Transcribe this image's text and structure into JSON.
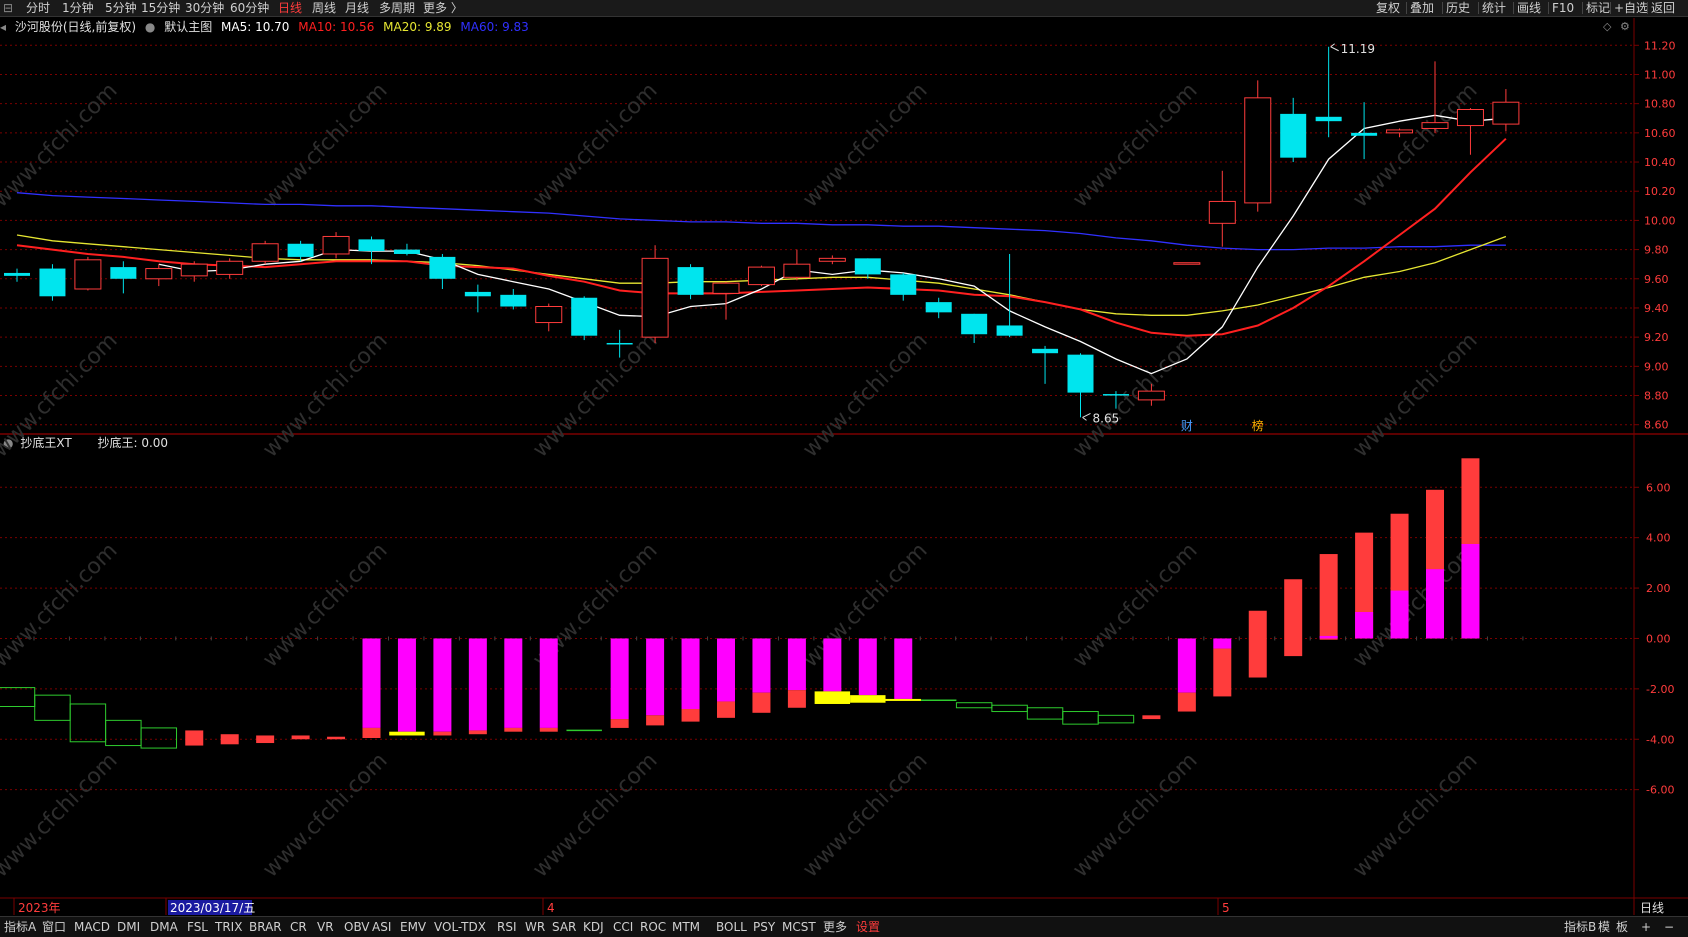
{
  "top_menu": {
    "left_items": [
      "分时",
      "1分钟",
      "5分钟",
      "15分钟",
      "30分钟",
      "60分钟",
      "日线",
      "周线",
      "月线",
      "多周期",
      "更多 〉"
    ],
    "active_index": 6,
    "right_items": [
      "复权",
      "叠加",
      "历史",
      "统计",
      "画线",
      "F10",
      "标记",
      "+自选",
      "返回"
    ]
  },
  "main_chart_info": {
    "stock": "沙河股份(日线,前复权)",
    "template": "默认主图",
    "ma5": "MA5: 10.70",
    "ma10": "MA10: 10.56",
    "ma20": "MA20: 9.89",
    "ma60": "MA60: 9.83"
  },
  "sub_chart_info": {
    "name": "抄底王XT",
    "value": "抄底王: 0.00"
  },
  "labels": {
    "max_price": "11.19",
    "min_price": "8.65",
    "marker_cai": "财",
    "marker_bang": "榜",
    "period": "日线"
  },
  "date_axis": [
    "2023年",
    "2023/03/17/五",
    "4",
    "5"
  ],
  "price_ticks": [
    "11.20",
    "11.00",
    "10.80",
    "10.60",
    "10.40",
    "10.20",
    "10.00",
    "9.80",
    "9.60",
    "9.40",
    "9.20",
    "9.00",
    "8.80",
    "8.60"
  ],
  "sub_ticks": [
    "6.00",
    "4.00",
    "2.00",
    "0.00",
    "-2.00",
    "-4.00",
    "-6.00"
  ],
  "bottom_tabs": [
    "指标A",
    "窗口",
    "MACD",
    "DMI",
    "DMA",
    "FSL",
    "TRIX",
    "BRAR",
    "CR",
    "VR",
    "OBV",
    "ASI",
    "EMV",
    "VOL-TDX",
    "RSI",
    "WR",
    "SAR",
    "KDJ",
    "CCI",
    "ROC",
    "MTM",
    "BOLL",
    "PSY",
    "MCST",
    "更多",
    "设置"
  ],
  "bottom_active": "设置",
  "bottom_right": [
    "指标B",
    "模",
    "板",
    "+",
    "−"
  ],
  "watermark": "www.cfchi.com",
  "colors": {
    "up": "#ff3c3c",
    "down": "#00e5ee",
    "ma5": "#ffffff",
    "ma10": "#ff2020",
    "ma20": "#e6e632",
    "ma60": "#3030ff",
    "magenta": "#ff00ff",
    "yellow": "#ffff00",
    "green": "#2ecc2e",
    "grid": "#7a0000"
  },
  "chart_data": {
    "type": "candlestick",
    "ylim": [
      8.55,
      11.25
    ],
    "candles": [
      {
        "o": 9.64,
        "h": 9.67,
        "l": 9.58,
        "c": 9.62
      },
      {
        "o": 9.67,
        "h": 9.7,
        "l": 9.45,
        "c": 9.48
      },
      {
        "o": 9.53,
        "h": 9.75,
        "l": 9.52,
        "c": 9.73
      },
      {
        "o": 9.68,
        "h": 9.72,
        "l": 9.5,
        "c": 9.6
      },
      {
        "o": 9.6,
        "h": 9.7,
        "l": 9.55,
        "c": 9.67
      },
      {
        "o": 9.62,
        "h": 9.72,
        "l": 9.58,
        "c": 9.7
      },
      {
        "o": 9.63,
        "h": 9.74,
        "l": 9.6,
        "c": 9.72
      },
      {
        "o": 9.72,
        "h": 9.86,
        "l": 9.7,
        "c": 9.84
      },
      {
        "o": 9.84,
        "h": 9.86,
        "l": 9.72,
        "c": 9.75
      },
      {
        "o": 9.77,
        "h": 9.92,
        "l": 9.74,
        "c": 9.89
      },
      {
        "o": 9.87,
        "h": 9.89,
        "l": 9.7,
        "c": 9.79
      },
      {
        "o": 9.8,
        "h": 9.84,
        "l": 9.76,
        "c": 9.77
      },
      {
        "o": 9.75,
        "h": 9.77,
        "l": 9.53,
        "c": 9.6
      },
      {
        "o": 9.51,
        "h": 9.56,
        "l": 9.37,
        "c": 9.48
      },
      {
        "o": 9.49,
        "h": 9.53,
        "l": 9.39,
        "c": 9.41
      },
      {
        "o": 9.3,
        "h": 9.43,
        "l": 9.24,
        "c": 9.41
      },
      {
        "o": 9.47,
        "h": 9.48,
        "l": 9.18,
        "c": 9.21
      },
      {
        "o": 9.16,
        "h": 9.25,
        "l": 9.06,
        "c": 9.15
      },
      {
        "o": 9.2,
        "h": 9.83,
        "l": 9.16,
        "c": 9.74
      },
      {
        "o": 9.68,
        "h": 9.7,
        "l": 9.46,
        "c": 9.49
      },
      {
        "o": 9.5,
        "h": 9.58,
        "l": 9.32,
        "c": 9.57
      },
      {
        "o": 9.56,
        "h": 9.69,
        "l": 9.55,
        "c": 9.68
      },
      {
        "o": 9.61,
        "h": 9.8,
        "l": 9.59,
        "c": 9.7
      },
      {
        "o": 9.72,
        "h": 9.76,
        "l": 9.7,
        "c": 9.74
      },
      {
        "o": 9.74,
        "h": 9.74,
        "l": 9.6,
        "c": 9.63
      },
      {
        "o": 9.63,
        "h": 9.64,
        "l": 9.45,
        "c": 9.49
      },
      {
        "o": 9.44,
        "h": 9.47,
        "l": 9.33,
        "c": 9.37
      },
      {
        "o": 9.36,
        "h": 9.36,
        "l": 9.16,
        "c": 9.22
      },
      {
        "o": 9.28,
        "h": 9.77,
        "l": 9.2,
        "c": 9.21
      },
      {
        "o": 9.12,
        "h": 9.14,
        "l": 8.88,
        "c": 9.09
      },
      {
        "o": 9.08,
        "h": 9.09,
        "l": 8.65,
        "c": 8.82
      },
      {
        "o": 8.81,
        "h": 8.83,
        "l": 8.71,
        "c": 8.8
      },
      {
        "o": 8.77,
        "h": 8.88,
        "l": 8.73,
        "c": 8.83
      },
      {
        "o": 9.71,
        "h": 9.71,
        "l": 9.71,
        "c": 9.71
      },
      {
        "o": 9.98,
        "h": 10.34,
        "l": 9.82,
        "c": 10.13
      },
      {
        "o": 10.12,
        "h": 10.96,
        "l": 10.06,
        "c": 10.84
      },
      {
        "o": 10.73,
        "h": 10.84,
        "l": 10.4,
        "c": 10.43
      },
      {
        "o": 10.71,
        "h": 11.19,
        "l": 10.57,
        "c": 10.68
      },
      {
        "o": 10.6,
        "h": 10.81,
        "l": 10.42,
        "c": 10.58
      },
      {
        "o": 10.6,
        "h": 10.63,
        "l": 10.57,
        "c": 10.62
      },
      {
        "o": 10.63,
        "h": 11.09,
        "l": 10.6,
        "c": 10.67
      },
      {
        "o": 10.65,
        "h": 10.77,
        "l": 10.45,
        "c": 10.76
      },
      {
        "o": 10.66,
        "h": 10.9,
        "l": 10.61,
        "c": 10.81
      }
    ],
    "ma5": [
      null,
      null,
      null,
      null,
      9.7,
      9.65,
      9.66,
      9.7,
      9.72,
      9.8,
      9.79,
      9.79,
      9.73,
      9.63,
      9.58,
      9.53,
      9.44,
      9.35,
      9.34,
      9.41,
      9.43,
      9.53,
      9.66,
      9.63,
      9.66,
      9.64,
      9.6,
      9.55,
      9.38,
      9.27,
      9.17,
      9.05,
      8.95,
      9.05,
      9.27,
      9.68,
      10.03,
      10.42,
      10.63,
      10.68,
      10.72,
      10.68,
      10.7
    ],
    "ma10": [
      9.83,
      9.8,
      9.77,
      9.75,
      9.72,
      9.7,
      9.69,
      9.68,
      9.7,
      9.72,
      9.72,
      9.72,
      9.69,
      9.68,
      9.67,
      9.62,
      9.58,
      9.52,
      9.5,
      9.5,
      9.5,
      9.51,
      9.52,
      9.53,
      9.54,
      9.53,
      9.52,
      9.49,
      9.48,
      9.44,
      9.39,
      9.3,
      9.23,
      9.21,
      9.22,
      9.28,
      9.4,
      9.55,
      9.72,
      9.9,
      10.08,
      10.33,
      10.56
    ],
    "ma20": [
      9.9,
      9.86,
      9.84,
      9.82,
      9.8,
      9.78,
      9.76,
      9.74,
      9.73,
      9.73,
      9.73,
      9.72,
      9.71,
      9.69,
      9.66,
      9.63,
      9.6,
      9.57,
      9.57,
      9.58,
      9.58,
      9.59,
      9.6,
      9.61,
      9.61,
      9.59,
      9.57,
      9.53,
      9.49,
      9.44,
      9.39,
      9.36,
      9.35,
      9.35,
      9.38,
      9.42,
      9.48,
      9.54,
      9.61,
      9.65,
      9.71,
      9.8,
      9.89
    ],
    "ma60": [
      10.19,
      10.17,
      10.16,
      10.15,
      10.14,
      10.13,
      10.12,
      10.11,
      10.11,
      10.1,
      10.1,
      10.09,
      10.08,
      10.07,
      10.06,
      10.05,
      10.03,
      10.01,
      10.0,
      9.99,
      9.99,
      9.98,
      9.98,
      9.97,
      9.97,
      9.96,
      9.96,
      9.95,
      9.94,
      9.93,
      9.91,
      9.88,
      9.86,
      9.83,
      9.81,
      9.8,
      9.8,
      9.81,
      9.81,
      9.82,
      9.82,
      9.83,
      9.83
    ],
    "sub_ylim": [
      -10.3,
      7.4
    ],
    "sub_bars": [
      {
        "kind": "green",
        "a": -1.95,
        "b": -2.7
      },
      {
        "kind": "green",
        "a": -2.25,
        "b": -3.25
      },
      {
        "kind": "green",
        "a": -2.6,
        "b": -4.1
      },
      {
        "kind": "green",
        "a": -3.25,
        "b": -4.25
      },
      {
        "kind": "green",
        "a": -3.55,
        "b": -4.35
      },
      {
        "kind": "red",
        "a": -3.65,
        "b": -4.25
      },
      {
        "kind": "red",
        "a": -3.8,
        "b": -4.2
      },
      {
        "kind": "red",
        "a": -3.85,
        "b": -4.15
      },
      {
        "kind": "red",
        "a": -3.85,
        "b": -4.0
      },
      {
        "kind": "red",
        "a": -3.9,
        "b": -4.0
      },
      {
        "kind": "magenta",
        "top": 0.0,
        "mag": -3.55,
        "red": -3.95
      },
      {
        "kind": "magenta",
        "top": 0.0,
        "mag": -3.7,
        "red": -3.7,
        "yellow": [
          -3.7,
          -3.85
        ]
      },
      {
        "kind": "magenta",
        "top": 0.0,
        "mag": -3.7,
        "red": -3.85
      },
      {
        "kind": "magenta",
        "top": 0.0,
        "mag": -3.65,
        "red": -3.8
      },
      {
        "kind": "magenta",
        "top": 0.0,
        "mag": -3.55,
        "red": -3.7
      },
      {
        "kind": "magenta",
        "top": 0.0,
        "mag": -3.55,
        "red": -3.7
      },
      {
        "kind": "line",
        "a": -3.65,
        "b": -3.65
      },
      {
        "kind": "magenta",
        "top": 0.0,
        "mag": -3.2,
        "red": -3.55
      },
      {
        "kind": "magenta",
        "top": 0.0,
        "mag": -3.05,
        "red": -3.45
      },
      {
        "kind": "magenta",
        "top": 0.0,
        "mag": -2.8,
        "red": -3.3
      },
      {
        "kind": "magenta",
        "top": 0.0,
        "mag": -2.5,
        "red": -3.15
      },
      {
        "kind": "magenta",
        "top": 0.0,
        "mag": -2.15,
        "red": -2.95
      },
      {
        "kind": "magenta",
        "top": 0.0,
        "mag": -2.05,
        "red": -2.75
      },
      {
        "kind": "magenta",
        "top": 0.0,
        "mag": -2.1,
        "red": -2.1,
        "yellow": [
          -2.1,
          -2.6
        ]
      },
      {
        "kind": "magenta",
        "top": 0.0,
        "mag": -2.25,
        "red": -2.25,
        "yellow": [
          -2.25,
          -2.55
        ]
      },
      {
        "kind": "magenta",
        "top": 0.0,
        "mag": -2.4,
        "red": -2.4,
        "yellow": [
          -2.4,
          -2.45
        ]
      },
      {
        "kind": "line",
        "a": -2.45,
        "b": -2.45
      },
      {
        "kind": "green",
        "a": -2.55,
        "b": -2.75
      },
      {
        "kind": "green",
        "a": -2.65,
        "b": -2.9
      },
      {
        "kind": "green",
        "a": -2.75,
        "b": -3.2
      },
      {
        "kind": "green",
        "a": -2.9,
        "b": -3.4
      },
      {
        "kind": "green",
        "a": -3.05,
        "b": -3.35
      },
      {
        "kind": "red",
        "a": -3.05,
        "b": -3.2
      },
      {
        "kind": "magenta",
        "top": 0.0,
        "mag": -2.15,
        "red": -2.9
      },
      {
        "kind": "redup",
        "top": -0.4,
        "bottom": -2.3,
        "mag": [
          0.0,
          -0.4
        ]
      },
      {
        "kind": "redup",
        "top": 1.1,
        "bottom": -1.55
      },
      {
        "kind": "redup",
        "top": 2.35,
        "bottom": -0.7
      },
      {
        "kind": "redup",
        "top": 3.35,
        "bottom": -0.05,
        "mag": [
          0.1,
          0.0
        ]
      },
      {
        "kind": "redup",
        "top": 4.2,
        "bottom": 0.0,
        "mag": [
          1.05,
          0.0
        ]
      },
      {
        "kind": "redup",
        "top": 4.95,
        "bottom": 0.0,
        "mag": [
          1.9,
          0.0
        ]
      },
      {
        "kind": "redup",
        "top": 5.9,
        "bottom": 0.0,
        "mag": [
          2.75,
          0.0
        ]
      },
      {
        "kind": "redup",
        "top": 7.15,
        "bottom": 0.0,
        "mag": [
          3.75,
          0.0
        ]
      }
    ]
  }
}
